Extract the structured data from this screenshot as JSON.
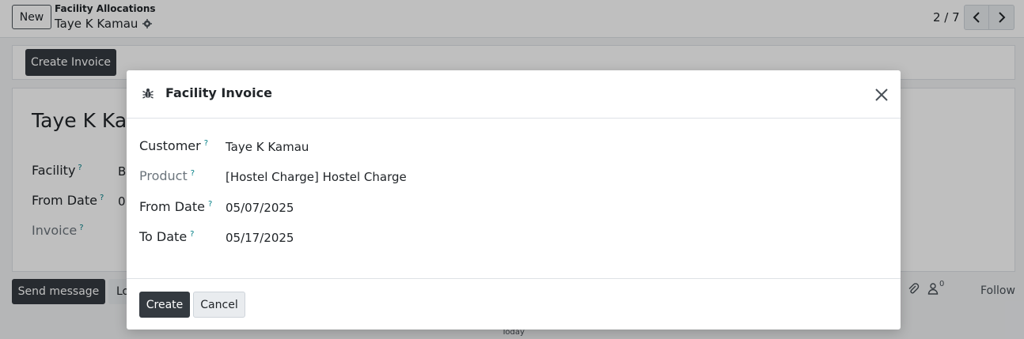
{
  "topbar": {
    "new_label": "New",
    "breadcrumb_parent": "Facility Allocations",
    "breadcrumb_current": "Taye K Kamau",
    "pager": "2 / 7"
  },
  "statusbar": {
    "create_invoice_label": "Create Invoice"
  },
  "sheet": {
    "title": "Taye K Kamau",
    "fields": [
      {
        "label": "Facility",
        "help": "?",
        "value": "B"
      },
      {
        "label": "From Date",
        "help": "?",
        "value": "0"
      },
      {
        "label": "Invoice",
        "help": "?",
        "value": ""
      }
    ]
  },
  "chatter": {
    "send_label": "Send message",
    "log_label": "Lo",
    "followers_count": "0",
    "follow_label": "Follow",
    "today_label": "Today"
  },
  "modal": {
    "title": "Facility Invoice",
    "fields": [
      {
        "label": "Customer",
        "help": "?",
        "value": "Taye K Kamau"
      },
      {
        "label": "Product",
        "help": "?",
        "value": "[Hostel Charge] Hostel Charge"
      },
      {
        "label": "From Date",
        "help": "?",
        "value": "05/07/2025"
      },
      {
        "label": "To Date",
        "help": "?",
        "value": "05/17/2025"
      }
    ],
    "create_label": "Create",
    "cancel_label": "Cancel"
  },
  "colors": {
    "primary_dark": "#343a40",
    "help_teal": "#017e84",
    "secondary_btn": "#e9ecef"
  },
  "icons": [
    "gear-icon",
    "chevron-left-icon",
    "chevron-right-icon",
    "bug-icon",
    "close-icon",
    "paperclip-icon",
    "user-icon"
  ]
}
